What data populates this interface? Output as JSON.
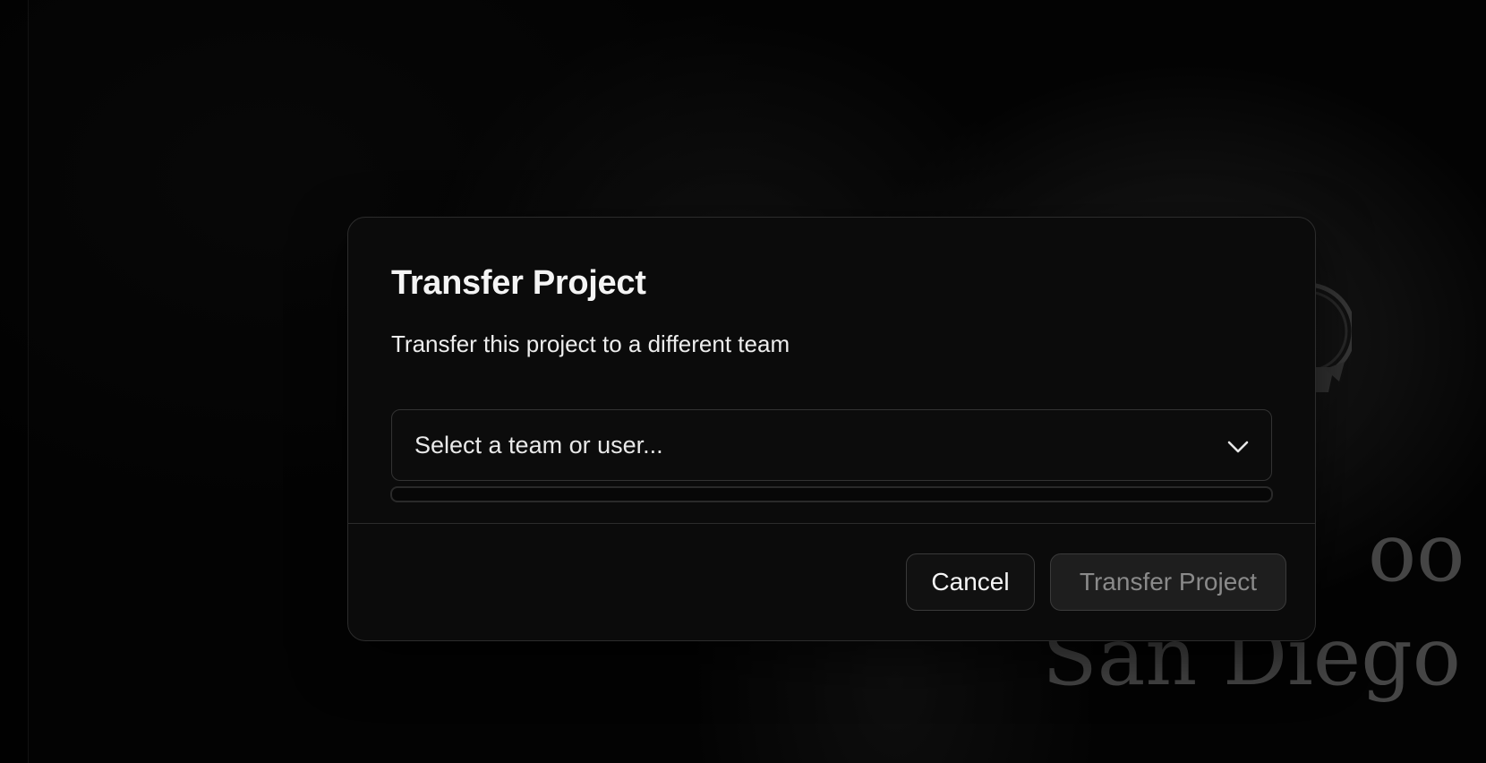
{
  "background": {
    "heading_line1": "oo A",
    "heading_line2": "San Diego"
  },
  "dialog": {
    "title": "Transfer Project",
    "description": "Transfer this project to a different team",
    "select": {
      "placeholder": "Select a team or user...",
      "icon": "chevron-down-icon"
    },
    "buttons": {
      "cancel_label": "Cancel",
      "transfer_label": "Transfer Project",
      "transfer_disabled": true
    }
  }
}
